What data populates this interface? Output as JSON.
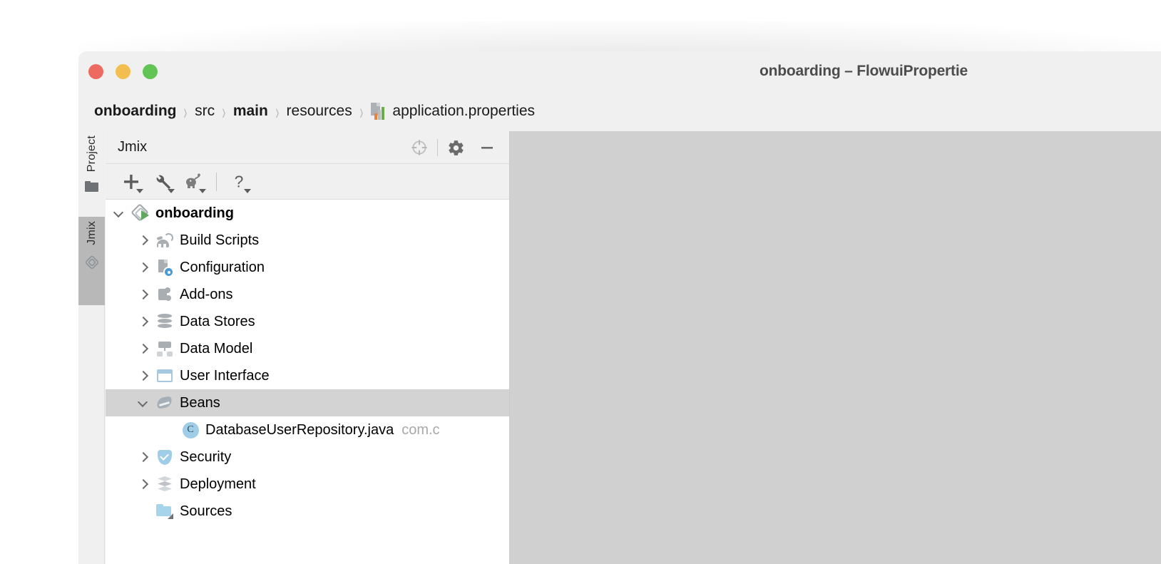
{
  "window": {
    "title": "onboarding – FlowuiPropertie",
    "traffic_lights": [
      "close",
      "minimize",
      "maximize"
    ],
    "colors": {
      "close": "#ec6a5f",
      "minimize": "#f3be50",
      "maximize": "#61c454"
    }
  },
  "breadcrumb": {
    "separator": "›",
    "items": [
      {
        "label": "onboarding",
        "bold": true
      },
      {
        "label": "src",
        "bold": false
      },
      {
        "label": "main",
        "bold": true
      },
      {
        "label": "resources",
        "bold": false
      },
      {
        "label": "application.properties",
        "bold": false,
        "icon": "properties-file-icon"
      }
    ]
  },
  "tool_strip": {
    "tabs": [
      {
        "label": "Project",
        "icon": "folder-icon",
        "selected": false
      },
      {
        "label": "Jmix",
        "icon": "jmix-diamond-icon",
        "selected": true
      }
    ]
  },
  "tool_window": {
    "title": "Jmix",
    "header_actions": [
      {
        "name": "locate-icon",
        "label": "Select Opened File"
      },
      {
        "name": "gear-icon",
        "label": "Options"
      },
      {
        "name": "minimize-icon",
        "label": "Hide"
      }
    ],
    "toolbar": [
      {
        "name": "add-button",
        "label": "New",
        "icon": "plus-icon",
        "has_dropdown": true
      },
      {
        "name": "tools-button",
        "label": "Tools",
        "icon": "wrench-icon",
        "has_dropdown": true
      },
      {
        "name": "gradle-button",
        "label": "Gradle",
        "icon": "gradle-elephant-icon",
        "has_dropdown": true
      },
      {
        "name": "help-button",
        "label": "Help",
        "icon": "question-icon",
        "has_dropdown": true
      }
    ],
    "tree": [
      {
        "label": "onboarding",
        "icon": "jmix-project-icon",
        "indent": 0,
        "state": "expanded",
        "bold": true,
        "selected": false,
        "sub": ""
      },
      {
        "label": "Build Scripts",
        "icon": "gradle-elephant-icon",
        "indent": 1,
        "state": "collapsed",
        "bold": false,
        "selected": false,
        "sub": ""
      },
      {
        "label": "Configuration",
        "icon": "configuration-icon",
        "indent": 1,
        "state": "collapsed",
        "bold": false,
        "selected": false,
        "sub": ""
      },
      {
        "label": "Add-ons",
        "icon": "puzzle-icon",
        "indent": 1,
        "state": "collapsed",
        "bold": false,
        "selected": false,
        "sub": ""
      },
      {
        "label": "Data Stores",
        "icon": "database-icon",
        "indent": 1,
        "state": "collapsed",
        "bold": false,
        "selected": false,
        "sub": ""
      },
      {
        "label": "Data Model",
        "icon": "data-model-icon",
        "indent": 1,
        "state": "collapsed",
        "bold": false,
        "selected": false,
        "sub": ""
      },
      {
        "label": "User Interface",
        "icon": "window-icon",
        "indent": 1,
        "state": "collapsed",
        "bold": false,
        "selected": false,
        "sub": ""
      },
      {
        "label": "Beans",
        "icon": "bean-icon",
        "indent": 1,
        "state": "expanded",
        "bold": false,
        "selected": true,
        "sub": ""
      },
      {
        "label": "DatabaseUserRepository.java",
        "icon": "java-class-icon",
        "indent": 2,
        "state": "none",
        "bold": false,
        "selected": false,
        "sub": "com.c"
      },
      {
        "label": "Security",
        "icon": "shield-icon",
        "indent": 1,
        "state": "collapsed",
        "bold": false,
        "selected": false,
        "sub": ""
      },
      {
        "label": "Deployment",
        "icon": "deployment-icon",
        "indent": 1,
        "state": "collapsed",
        "bold": false,
        "selected": false,
        "sub": ""
      },
      {
        "label": "Sources",
        "icon": "sources-folder-icon",
        "indent": 1,
        "state": "none",
        "bold": false,
        "selected": false,
        "sub": ""
      }
    ]
  },
  "editor": {
    "background": "#d0d0d0",
    "content": ""
  }
}
